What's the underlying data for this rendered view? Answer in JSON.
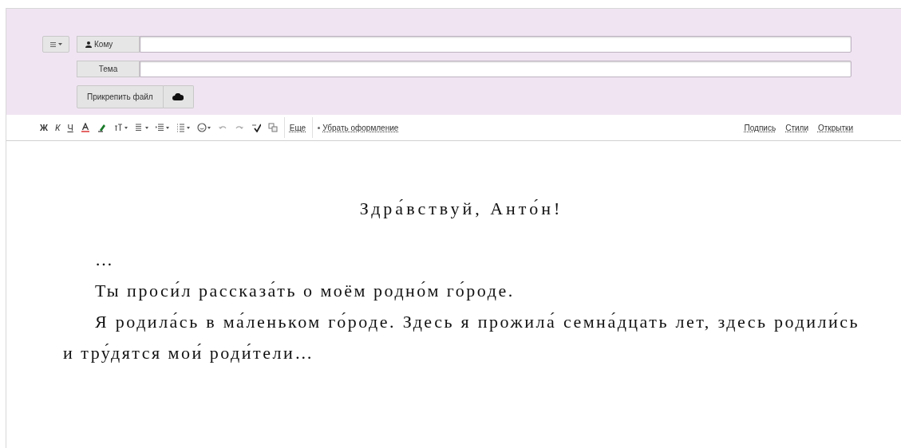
{
  "compose": {
    "menu_button": {
      "kind": "menu"
    },
    "fields": [
      {
        "label": "Кому",
        "kind": "recipient"
      },
      {
        "label": "Тема",
        "kind": "subject"
      }
    ],
    "attach_button": "Прикрепить файл"
  },
  "toolbar": {
    "tools": [
      {
        "kind": "bold",
        "label": "Ж"
      },
      {
        "kind": "italic",
        "label": "К"
      },
      {
        "kind": "underline",
        "label": "Ч"
      },
      {
        "kind": "font-color"
      },
      {
        "kind": "highlight"
      },
      {
        "kind": "text-size"
      },
      {
        "kind": "align"
      },
      {
        "kind": "indent"
      },
      {
        "kind": "list"
      },
      {
        "kind": "emoji"
      },
      {
        "kind": "undo"
      },
      {
        "kind": "redo"
      },
      {
        "kind": "spellcheck"
      },
      {
        "kind": "translate"
      }
    ],
    "more": "Еще",
    "clear_format": "Убрать оформление",
    "links": [
      "Подпись",
      "Стили",
      "Открытки"
    ]
  },
  "letter": {
    "greeting": "Здра́вствуй, Анто́н!",
    "paragraphs": [
      "…",
      "Ты проси́л рассказа́ть о моём родно́м го́роде.",
      "Я родила́сь в ма́леньком го́роде. Здесь я прожила́ семна́дцать лет, здесь родили́сь и тру́дятся мои́ роди́тели…"
    ]
  }
}
